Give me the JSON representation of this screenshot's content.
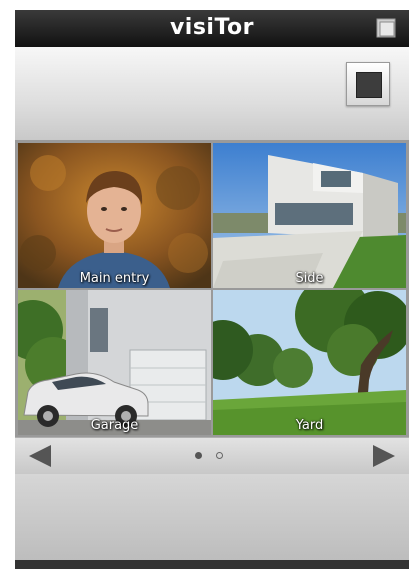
{
  "app": {
    "title": "visiTor"
  },
  "icons": {
    "window": "window-icon",
    "stop": "stop-square-icon",
    "prev": "left-arrow-icon",
    "next": "right-arrow-icon"
  },
  "cameras": [
    {
      "label": "Main entry"
    },
    {
      "label": "Side"
    },
    {
      "label": "Garage"
    },
    {
      "label": "Yard"
    }
  ],
  "pager": {
    "pages": 2,
    "current": 1
  },
  "colors": {
    "titlebar": "#1a1a1a",
    "accent": "#555555"
  }
}
